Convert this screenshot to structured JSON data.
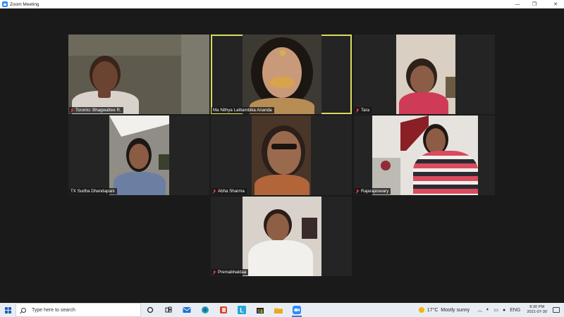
{
  "window": {
    "title": "Zoom Meeting",
    "minimize": "—",
    "restore": "❐",
    "close": "✕"
  },
  "participants": [
    {
      "name": "Toronto: Bhagwattee R.",
      "muted": true,
      "active": false
    },
    {
      "name": "Ma Nithya Lalitambika Ananda",
      "muted": false,
      "active": true
    },
    {
      "name": "Tara",
      "muted": true,
      "active": false
    },
    {
      "name": "TX Sudha Dhandapani",
      "muted": false,
      "active": false
    },
    {
      "name": "Abha Sharma",
      "muted": true,
      "active": false
    },
    {
      "name": "Rajarajeswary",
      "muted": true,
      "active": false
    },
    {
      "name": "Premabhaktaa",
      "muted": true,
      "active": false
    }
  ],
  "taskbar": {
    "search_placeholder": "Type here to search",
    "apps": [
      "cortana-icon",
      "task-view-icon",
      "mail-icon",
      "edge-icon",
      "office-icon",
      "app-l-icon",
      "store-icon",
      "file-explorer-icon",
      "zoom-icon"
    ],
    "app_l_letter": "L",
    "weather": {
      "temp": "17°C",
      "condition": "Mostly sunny"
    },
    "language": "ENG",
    "time": "8:30 PM",
    "date": "2021-07-30"
  },
  "colors": {
    "active_border": "#d7db63",
    "muted_icon": "#e03a3a",
    "zoom_blue": "#2d8cff"
  }
}
